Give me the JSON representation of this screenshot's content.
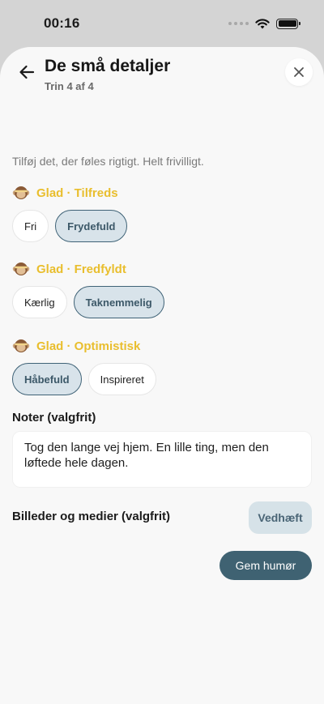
{
  "status": {
    "time": "00:16"
  },
  "header": {
    "title": "De små detaljer",
    "step": "Trin 4 af 4"
  },
  "intro": "Tilføj det, der føles rigtigt. Helt frivilligt.",
  "emotions": [
    {
      "label": "Glad · Tilfreds",
      "chips": [
        {
          "label": "Fri",
          "selected": false
        },
        {
          "label": "Frydefuld",
          "selected": true
        }
      ]
    },
    {
      "label": "Glad · Fredfyldt",
      "chips": [
        {
          "label": "Kærlig",
          "selected": false
        },
        {
          "label": "Taknemmelig",
          "selected": true
        }
      ]
    },
    {
      "label": "Glad · Optimistisk",
      "chips": [
        {
          "label": "Håbefuld",
          "selected": true
        },
        {
          "label": "Inspireret",
          "selected": false
        }
      ]
    }
  ],
  "notes": {
    "label": "Noter (valgfrit)",
    "value": "Tog den lange vej hjem. En lille ting, men den løftede hele dagen."
  },
  "media": {
    "label": "Billeder og medier (valgfrit)",
    "attach_label": "Vedhæft"
  },
  "save_label": "Gem humør",
  "colors": {
    "accent": "#3f6272",
    "emotion_title": "#e9be2d",
    "chip_selected_bg": "#d8e3ea"
  },
  "icons": {
    "back": "arrow-left-icon",
    "close": "close-icon",
    "emotion": "monkey-emoji-icon"
  }
}
